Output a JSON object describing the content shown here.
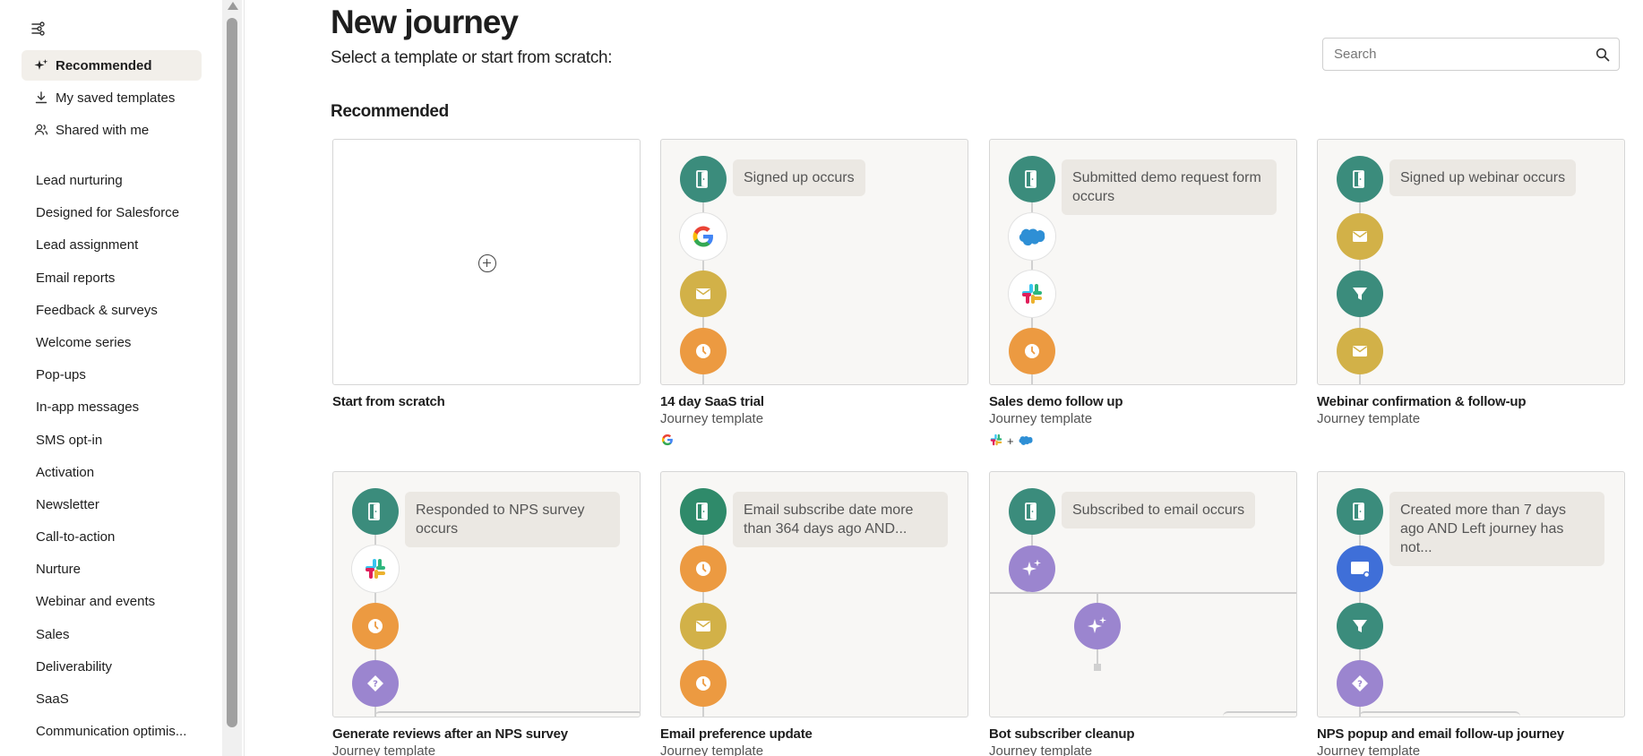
{
  "sidebar": {
    "nav": [
      {
        "label": "Recommended",
        "icon": "sparkle-icon",
        "active": true
      },
      {
        "label": "My saved templates",
        "icon": "download-icon",
        "active": false
      },
      {
        "label": "Shared with me",
        "icon": "users-icon",
        "active": false
      }
    ],
    "categories": [
      "Lead nurturing",
      "Designed for Salesforce",
      "Lead assignment",
      "Email reports",
      "Feedback & surveys",
      "Welcome series",
      "Pop-ups",
      "In-app messages",
      "SMS opt-in",
      "Activation",
      "Newsletter",
      "Call-to-action",
      "Nurture",
      "Webinar and events",
      "Sales",
      "Deliverability",
      "SaaS",
      "Communication optimis..."
    ]
  },
  "header": {
    "title": "New journey",
    "subtitle": "Select a template or start from scratch:"
  },
  "search": {
    "placeholder": "Search",
    "value": ""
  },
  "section": {
    "title": "Recommended"
  },
  "cards": [
    {
      "title": "Start from scratch",
      "subtitle": ""
    },
    {
      "title": "14 day SaaS trial",
      "subtitle": "Journey template",
      "trigger": "Signed up occurs",
      "steps": [
        "door-icon",
        "google-icon",
        "email-icon",
        "clock-icon"
      ],
      "integrations": [
        "google-icon"
      ]
    },
    {
      "title": "Sales demo follow up",
      "subtitle": "Journey template",
      "trigger": "Submitted demo request form occurs",
      "steps": [
        "door-icon",
        "salesforce-icon",
        "slack-icon",
        "clock-icon"
      ],
      "integrations": [
        "slack-icon",
        "salesforce-icon"
      ],
      "integration_joiner": "+"
    },
    {
      "title": "Webinar confirmation & follow-up",
      "subtitle": "Journey template",
      "trigger": "Signed up webinar occurs",
      "steps": [
        "door-icon",
        "email-icon",
        "filter-icon",
        "email-icon"
      ]
    },
    {
      "title": "Generate reviews after an NPS survey",
      "subtitle": "Journey template",
      "trigger": "Responded to NPS survey occurs",
      "steps": [
        "door-icon",
        "slack-icon",
        "clock-icon",
        "question-diamond-icon"
      ]
    },
    {
      "title": "Email preference update",
      "subtitle": "Journey template",
      "trigger": "Email subscribe date more than 364 days ago AND...",
      "steps": [
        "door-icon",
        "clock-icon",
        "email-icon",
        "clock-icon"
      ]
    },
    {
      "title": "Bot subscriber cleanup",
      "subtitle": "Journey template",
      "trigger": "Subscribed to email occurs",
      "steps": [
        "door-icon",
        "sparkles-icon",
        "sparkles-icon"
      ]
    },
    {
      "title": "NPS popup and email follow-up journey",
      "subtitle": "Journey template",
      "trigger": "Created more than 7 days ago AND Left journey has not...",
      "steps": [
        "door-icon",
        "popup-icon",
        "filter-icon",
        "question-diamond-icon"
      ]
    }
  ],
  "colors": {
    "teal": "#3b8c7c",
    "gold": "#d2b148",
    "orange": "#ec9a41",
    "purple": "#9b85cf",
    "blue": "#3f6fd8",
    "active_nav_bg": "#f2efea",
    "card_bg": "#f8f7f5"
  }
}
